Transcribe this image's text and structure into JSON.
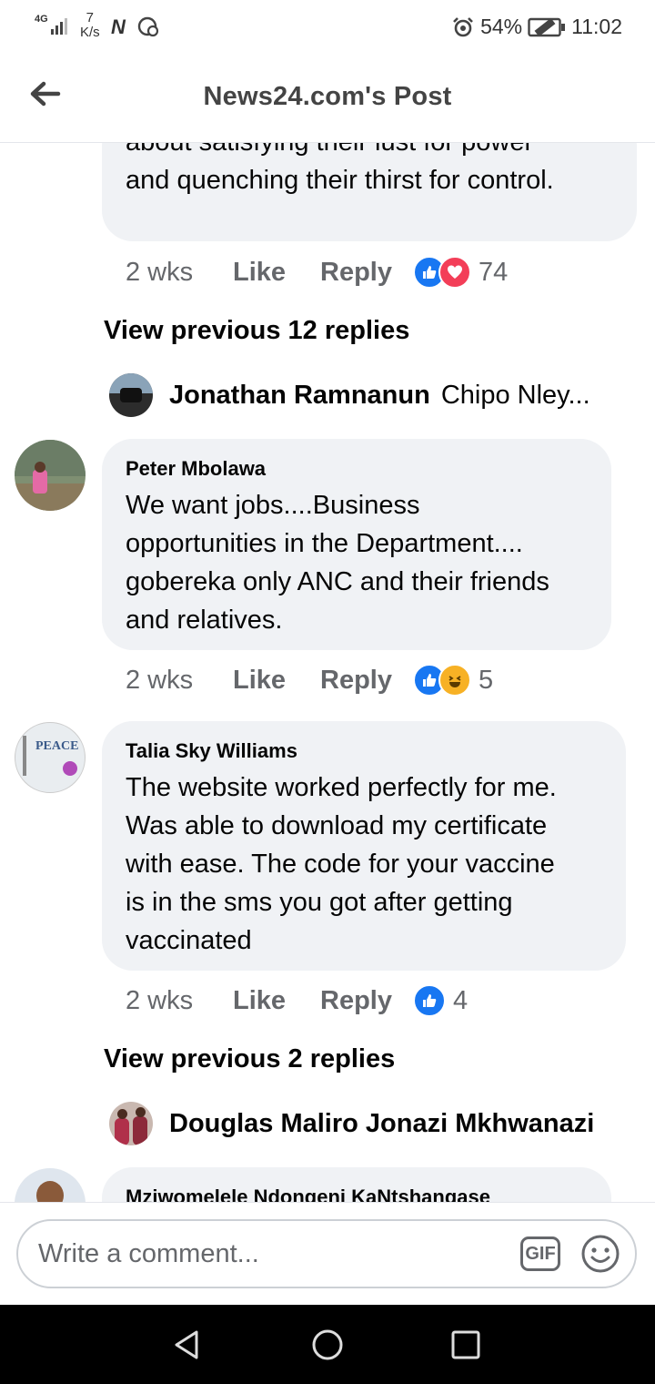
{
  "status_bar": {
    "network": "4G",
    "speed_value": "7",
    "speed_unit": "K/s",
    "carrier_glyph": "N",
    "battery": "54%",
    "time": "11:02"
  },
  "header": {
    "title": "News24.com's Post"
  },
  "comments": [
    {
      "text_lines": [
        "about satisfying their lust for power",
        "and quenching their thirst for control."
      ],
      "time": "2 wks",
      "like_label": "Like",
      "reply_label": "Reply",
      "reaction_count": "74",
      "reactions": [
        "like",
        "love"
      ]
    },
    {
      "author": "Peter Mbolawa",
      "text_lines": [
        "We want jobs....Business",
        "opportunities in the Department....",
        "gobereka only ANC and their friends",
        "and relatives."
      ],
      "time": "2 wks",
      "like_label": "Like",
      "reply_label": "Reply",
      "reaction_count": "5",
      "reactions": [
        "like",
        "haha"
      ]
    },
    {
      "author": "Talia Sky Williams",
      "text_lines": [
        "The website worked perfectly for me.",
        "Was able to download my certificate",
        "with ease. The code for your vaccine",
        "is in the sms you got after getting",
        "vaccinated"
      ],
      "time": "2 wks",
      "like_label": "Like",
      "reply_label": "Reply",
      "reaction_count": "4",
      "reactions": [
        "like"
      ]
    },
    {
      "author": "Mziwomelele Ndongeni KaNtshangase"
    }
  ],
  "view_previous": [
    "View previous 12 replies",
    "View previous 2 replies"
  ],
  "reply_previews": [
    {
      "name": "Jonathan Ramnanun",
      "preview": "Chipo Nley..."
    },
    {
      "name": "Douglas Maliro Jonazi Mkhwanazi",
      "preview": ""
    }
  ],
  "composer": {
    "placeholder": "Write a comment...",
    "gif_label": "GIF"
  },
  "colors": {
    "like_blue": "#1877f2",
    "love_red": "#f33e58",
    "haha_yellow": "#f7b125",
    "bubble": "#f0f2f5",
    "meta_gray": "#65676b"
  },
  "icons": [
    "back-arrow-icon",
    "like-reaction-icon",
    "love-reaction-icon",
    "haha-reaction-icon",
    "smiley-icon",
    "nav-back-icon",
    "nav-home-icon",
    "nav-recents-icon"
  ]
}
